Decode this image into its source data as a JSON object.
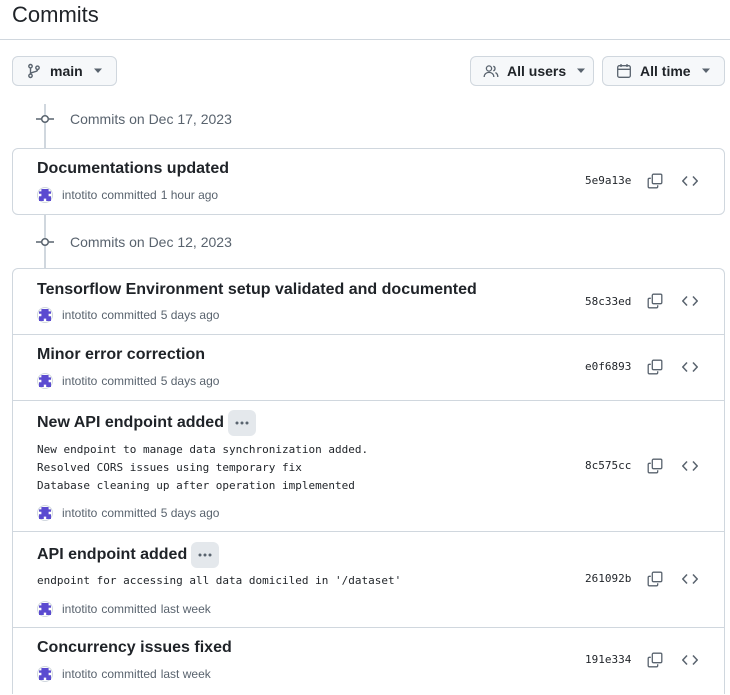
{
  "page": {
    "title": "Commits"
  },
  "filters": {
    "branch": "main",
    "users": "All users",
    "time": "All time"
  },
  "groups": [
    {
      "label": "Commits on Dec 17, 2023",
      "commits": [
        {
          "message": "Documentations updated",
          "author": "intotito",
          "action": "committed",
          "when": "1 hour ago",
          "sha": "5e9a13e",
          "has_description": false
        }
      ]
    },
    {
      "label": "Commits on Dec 12, 2023",
      "commits": [
        {
          "message": "Tensorflow Environment setup validated and documented",
          "author": "intotito",
          "action": "committed",
          "when": "5 days ago",
          "sha": "58c33ed",
          "has_description": false
        },
        {
          "message": "Minor error correction",
          "author": "intotito",
          "action": "committed",
          "when": "5 days ago",
          "sha": "e0f6893",
          "has_description": false
        },
        {
          "message": "New API endpoint added",
          "author": "intotito",
          "action": "committed",
          "when": "5 days ago",
          "sha": "8c575cc",
          "has_description": true,
          "description": [
            "New endpoint to manage data synchronization added.",
            "Resolved CORS issues using temporary fix",
            "Database cleaning up after operation implemented"
          ]
        },
        {
          "message": "API endpoint added",
          "author": "intotito",
          "action": "committed",
          "when": "last week",
          "sha": "261092b",
          "has_description": true,
          "description": [
            "endpoint for accessing all data domiciled in '/dataset'"
          ]
        },
        {
          "message": "Concurrency issues fixed",
          "author": "intotito",
          "action": "committed",
          "when": "last week",
          "sha": "191e334",
          "has_description": false
        }
      ]
    }
  ],
  "icons": {
    "branch": "git-branch-icon",
    "users": "people-icon",
    "time": "calendar-icon",
    "caret": "triangle-down-icon",
    "group": "git-commit-icon",
    "copy": "copy-icon",
    "browse": "code-icon",
    "expand": "kebab-horizontal-icon"
  },
  "colors": {
    "border": "#d0d7de",
    "muted": "#59636e",
    "avatar": "#5b4bd0"
  }
}
